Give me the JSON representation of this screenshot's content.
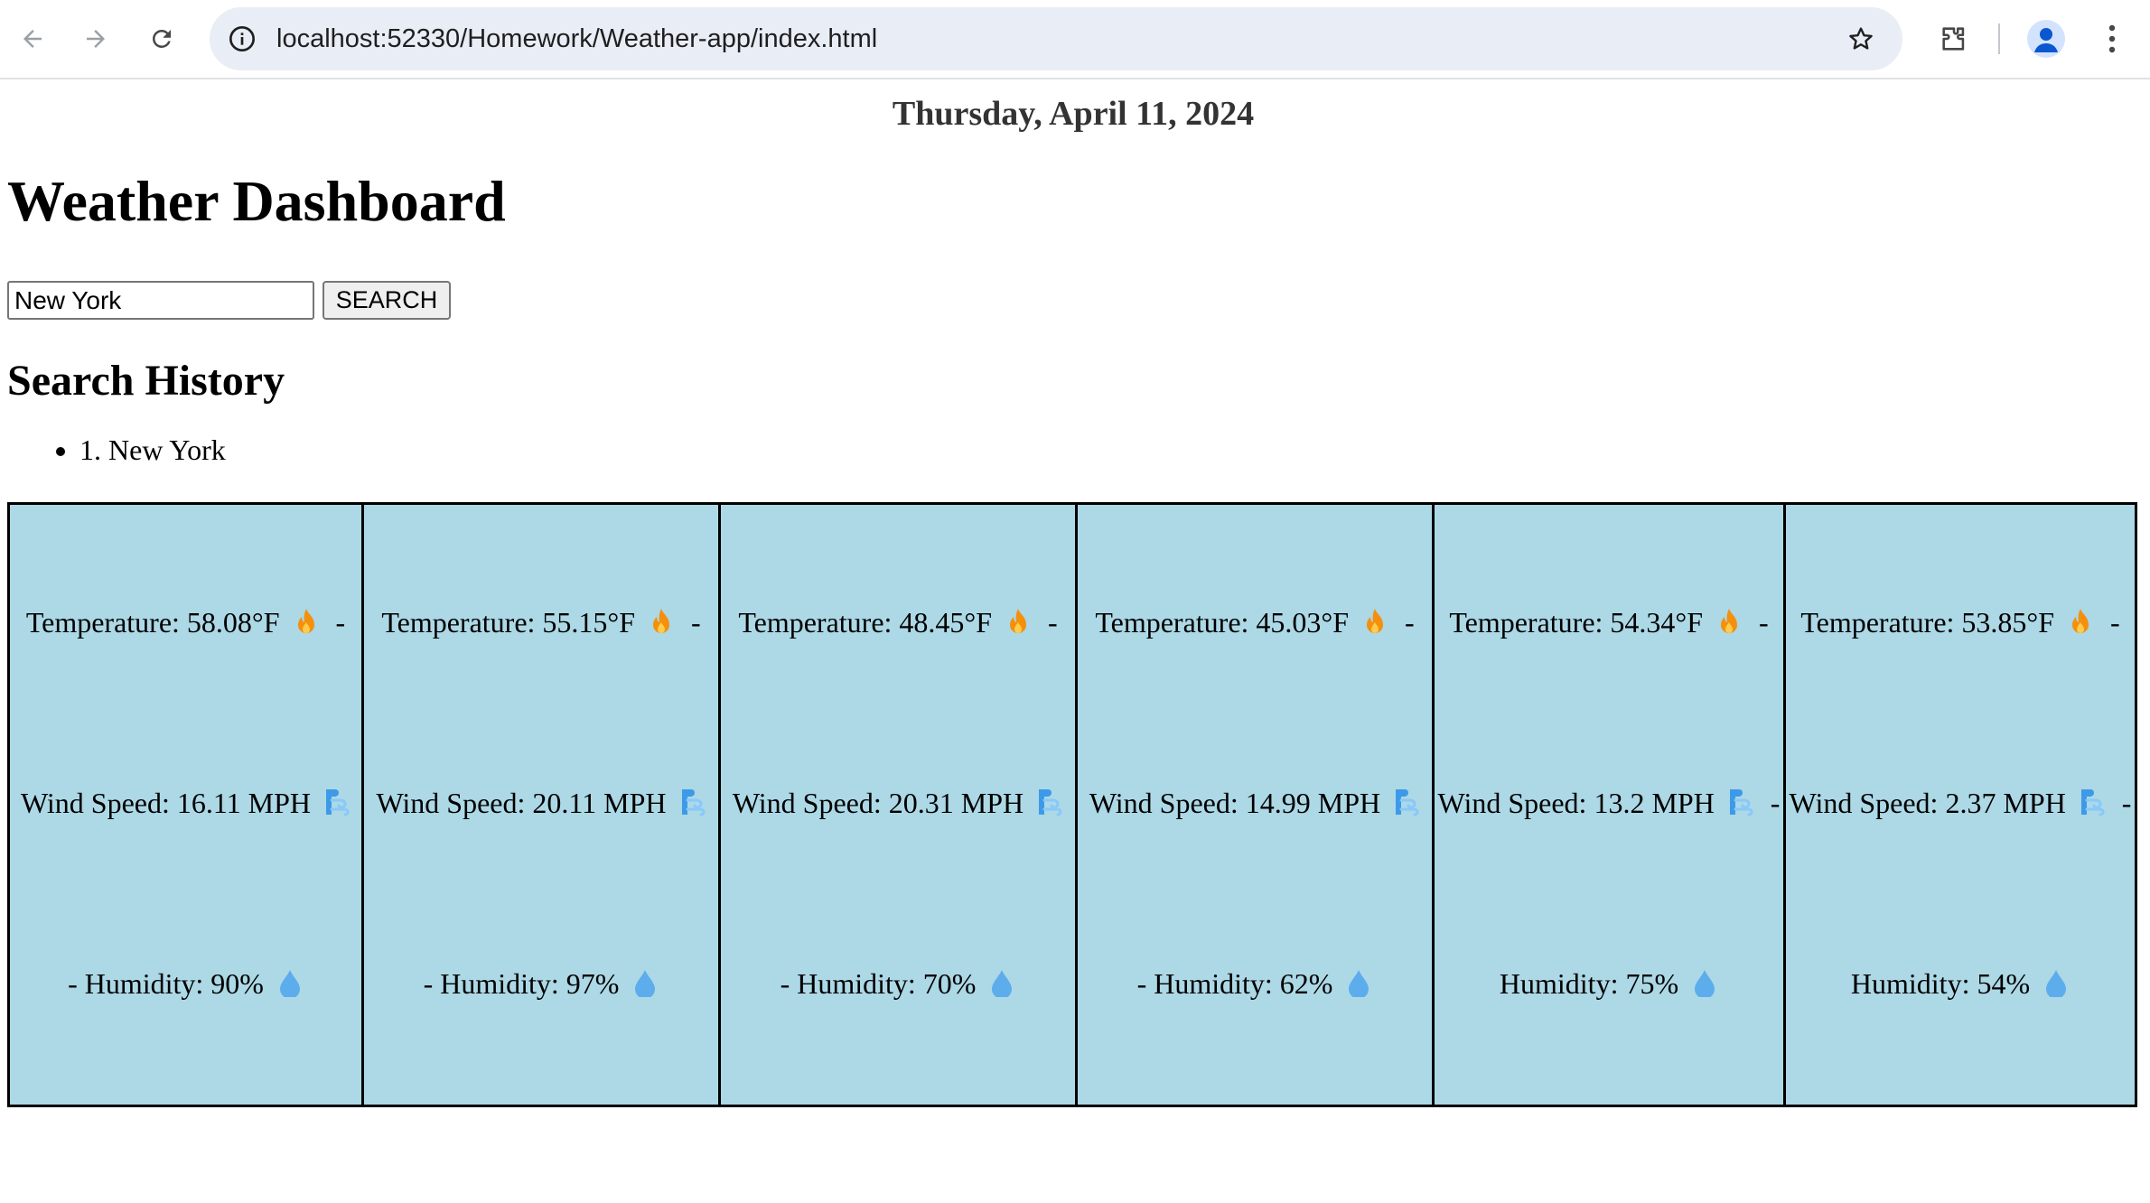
{
  "browser": {
    "url": "localhost:52330/Homework/Weather-app/index.html",
    "icons": [
      "back-arrow-icon",
      "forward-arrow-icon",
      "reload-icon",
      "info-icon",
      "star-icon",
      "extensions-icon",
      "profile-icon",
      "menu-icon"
    ]
  },
  "page": {
    "date": "Thursday, April 11, 2024",
    "title": "Weather Dashboard",
    "search": {
      "value": "New York",
      "button_label": "SEARCH"
    },
    "history": {
      "title": "Search History",
      "items": [
        "1. New York"
      ]
    }
  },
  "forecast": [
    {
      "temperature": "Temperature: 58.08°F",
      "wind": "Wind Speed: 16.11 MPH",
      "humidity": "- Humidity: 90%"
    },
    {
      "temperature": "Temperature: 55.15°F",
      "wind": "Wind Speed: 20.11 MPH",
      "humidity": "- Humidity: 97%"
    },
    {
      "temperature": "Temperature: 48.45°F",
      "wind": "Wind Speed: 20.31 MPH",
      "humidity": "- Humidity: 70%"
    },
    {
      "temperature": "Temperature: 45.03°F",
      "wind": "Wind Speed: 14.99 MPH",
      "humidity": "- Humidity: 62%"
    },
    {
      "temperature": "Temperature: 54.34°F",
      "wind": "Wind Speed: 13.2 MPH",
      "humidity": "Humidity: 75%"
    },
    {
      "temperature": "Temperature: 53.85°F",
      "wind": "Wind Speed: 2.37 MPH",
      "humidity": "Humidity: 54%"
    }
  ],
  "separators": {
    "temperature": "-",
    "wind": "-"
  },
  "colors": {
    "card_background": "#add8e6",
    "flame": "#f4900c",
    "wind": "#3d9ae8",
    "droplet": "#5dadec"
  }
}
